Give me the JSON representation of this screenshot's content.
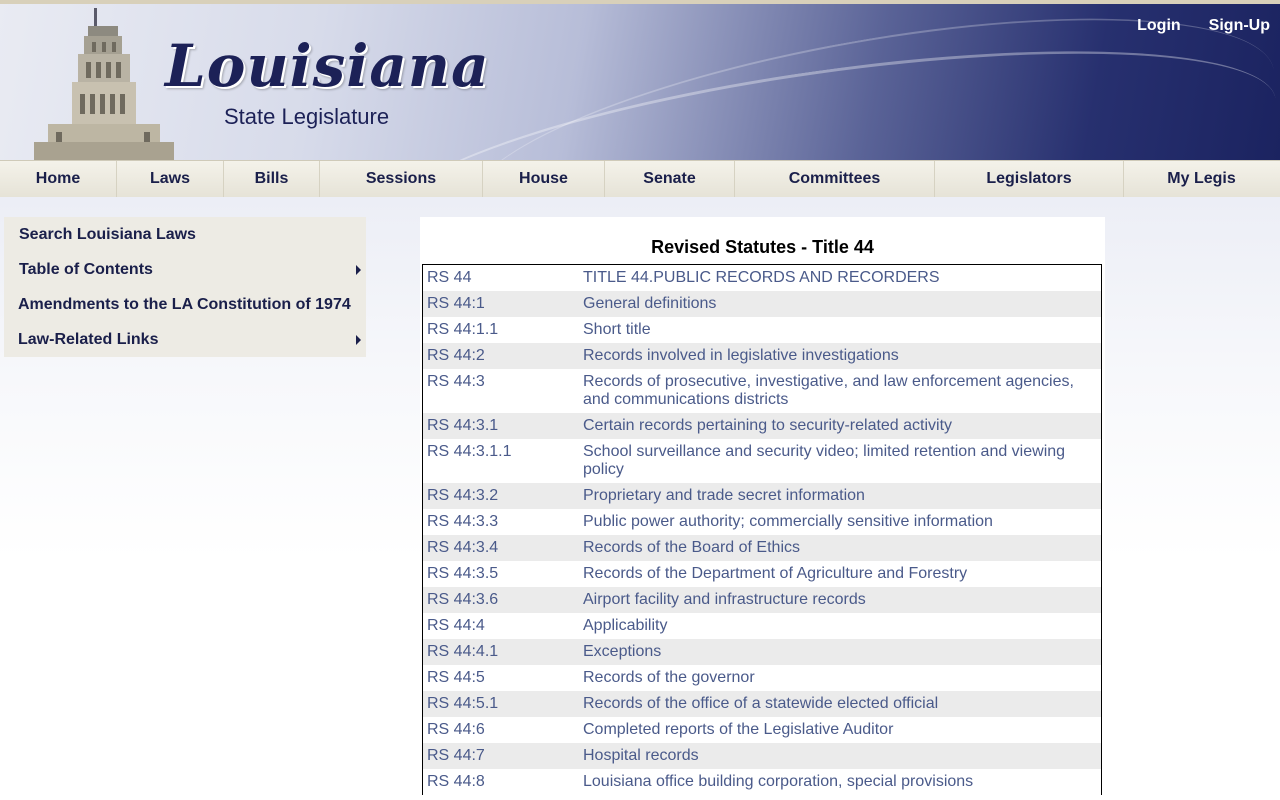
{
  "header": {
    "logo_script": "Louisiana",
    "logo_subtitle": "State Legislature",
    "login": "Login",
    "signup": "Sign-Up"
  },
  "nav": [
    {
      "label": "Home"
    },
    {
      "label": "Laws"
    },
    {
      "label": "Bills"
    },
    {
      "label": "Sessions"
    },
    {
      "label": "House"
    },
    {
      "label": "Senate"
    },
    {
      "label": "Committees"
    },
    {
      "label": "Legislators"
    },
    {
      "label": "My Legis"
    }
  ],
  "sidebar": [
    {
      "label": "Search Louisiana Laws",
      "submenu": false
    },
    {
      "label": "Table of Contents",
      "submenu": true
    },
    {
      "label": "Amendments to the LA Constitution of 1974",
      "submenu": false
    },
    {
      "label": "Law-Related Links",
      "submenu": true
    }
  ],
  "content": {
    "title": "Revised Statutes - Title 44",
    "rows": [
      {
        "num": "RS 44",
        "title": "TITLE 44.PUBLIC RECORDS AND RECORDERS"
      },
      {
        "num": "RS 44:1",
        "title": "General definitions"
      },
      {
        "num": "RS 44:1.1",
        "title": "Short title"
      },
      {
        "num": "RS 44:2",
        "title": "Records involved in legislative investigations"
      },
      {
        "num": "RS 44:3",
        "title": "Records of prosecutive, investigative, and law enforcement agencies, and communications districts"
      },
      {
        "num": "RS 44:3.1",
        "title": "Certain records pertaining to security-related activity"
      },
      {
        "num": "RS 44:3.1.1",
        "title": "School surveillance and security video; limited retention and viewing policy"
      },
      {
        "num": "RS 44:3.2",
        "title": "Proprietary and trade secret information"
      },
      {
        "num": "RS 44:3.3",
        "title": "Public power authority; commercially sensitive information"
      },
      {
        "num": "RS 44:3.4",
        "title": "Records of the Board of Ethics"
      },
      {
        "num": "RS 44:3.5",
        "title": "Records of the Department of Agriculture and Forestry"
      },
      {
        "num": "RS 44:3.6",
        "title": "Airport facility and infrastructure records"
      },
      {
        "num": "RS 44:4",
        "title": "Applicability"
      },
      {
        "num": "RS 44:4.1",
        "title": "Exceptions"
      },
      {
        "num": "RS 44:5",
        "title": "Records of the governor"
      },
      {
        "num": "RS 44:5.1",
        "title": "Records of the office of a statewide elected official"
      },
      {
        "num": "RS 44:6",
        "title": "Completed reports of the Legislative Auditor"
      },
      {
        "num": "RS 44:7",
        "title": "Hospital records"
      },
      {
        "num": "RS 44:8",
        "title": "Louisiana office building corporation, special provisions"
      }
    ]
  }
}
